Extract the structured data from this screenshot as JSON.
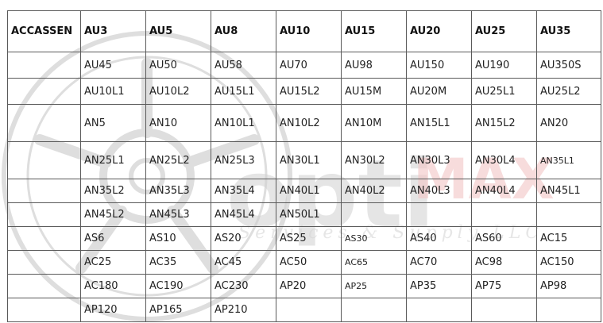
{
  "watermark": {
    "brand": "OptiMAX",
    "brand_part1": "opti",
    "brand_part2": "MAX",
    "tagline": "Services & Supply LLC",
    "colors": {
      "wheel": "#dcdcdc",
      "opti": "#c8c8c8",
      "max": "#f4c9c9"
    }
  },
  "table": {
    "headers": [
      "ACCASSEN",
      "AU3",
      "AU5",
      "AU8",
      "AU10",
      "AU15",
      "AU20",
      "AU25",
      "AU35"
    ],
    "rows": [
      [
        "",
        "AU45",
        "AU50",
        "AU58",
        "AU70",
        "AU98",
        "AU150",
        "AU190",
        "AU350S"
      ],
      [
        "",
        "AU10L1",
        "AU10L2",
        "AU15L1",
        "AU15L2",
        "AU15M",
        "AU20M",
        "AU25L1",
        "AU25L2"
      ],
      [
        "",
        "AN5",
        "AN10",
        "AN10L1",
        "AN10L2",
        "AN10M",
        "AN15L1",
        "AN15L2",
        "AN20"
      ],
      [
        "",
        "AN25L1",
        "AN25L2",
        "AN25L3",
        "AN30L1",
        "AN30L2",
        "AN30L3",
        "AN30L4",
        "AN35L1"
      ],
      [
        "",
        "AN35L2",
        "AN35L3",
        "AN35L4",
        "AN40L1",
        "AN40L2",
        "AN40L3",
        "AN40L4",
        "AN45L1"
      ],
      [
        "",
        "AN45L2",
        "AN45L3",
        "AN45L4",
        "AN50L1",
        "",
        "",
        "",
        ""
      ],
      [
        "",
        "AS6",
        "AS10",
        "AS20",
        "AS25",
        "AS30",
        "AS40",
        "AS60",
        "AC15"
      ],
      [
        "",
        "AC25",
        "AC35",
        "AC45",
        "AC50",
        "AC65",
        "AC70",
        "AC98",
        "AC150"
      ],
      [
        "",
        "AC180",
        "AC190",
        "AC230",
        "AP20",
        "AP25",
        "AP35",
        "AP75",
        "AP98"
      ],
      [
        "",
        "AP120",
        "AP165",
        "AP210",
        "",
        "",
        "",
        "",
        ""
      ]
    ]
  }
}
